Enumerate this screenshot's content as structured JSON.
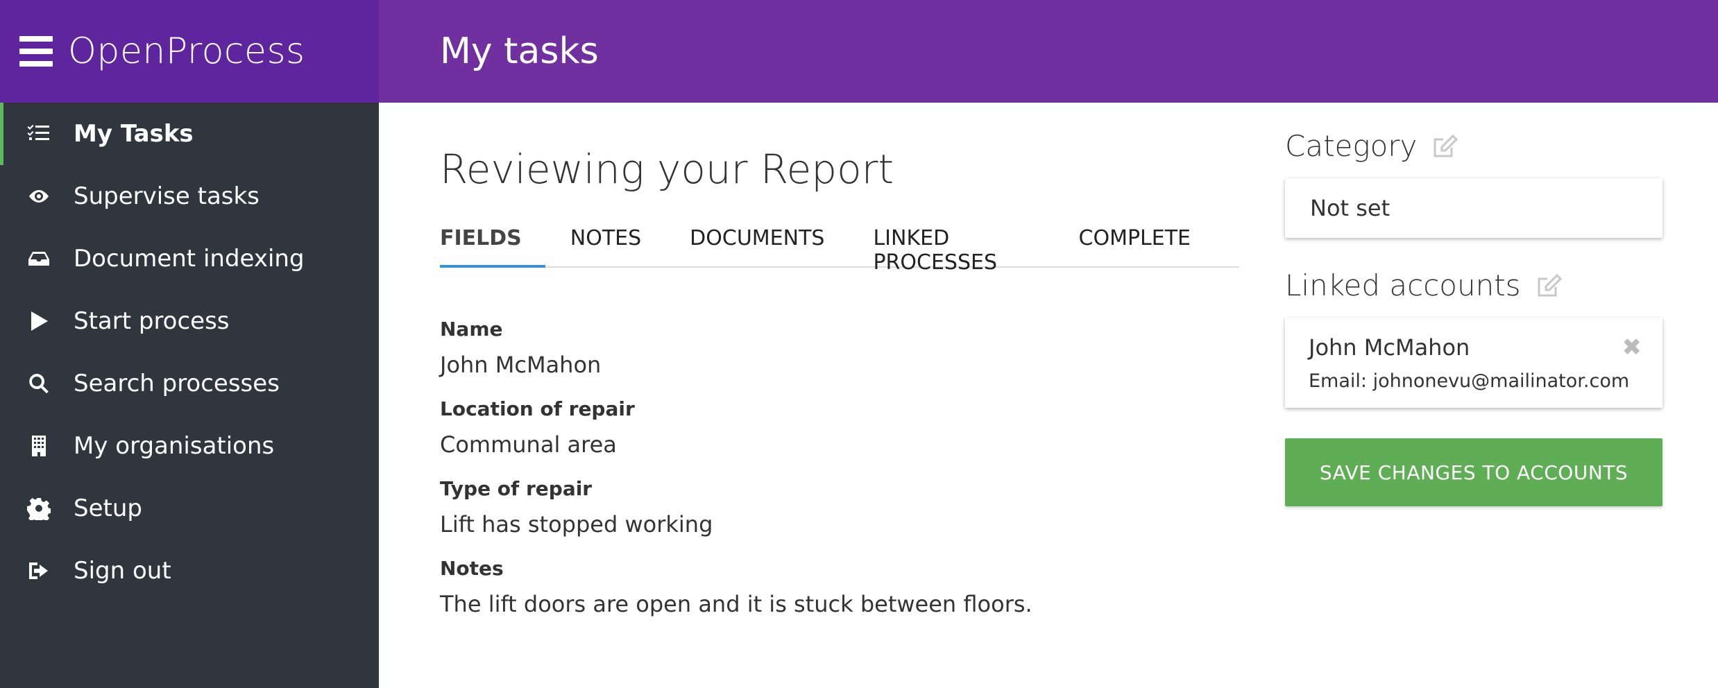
{
  "brand": {
    "name": "OpenProcess",
    "menu_icon": "hamburger-icon"
  },
  "header": {
    "title": "My tasks"
  },
  "sidebar": {
    "items": [
      {
        "label": "My Tasks",
        "icon": "tasks-list-icon",
        "active": true
      },
      {
        "label": "Supervise tasks",
        "icon": "eye-icon"
      },
      {
        "label": "Document indexing",
        "icon": "inbox-icon"
      },
      {
        "label": "Start process",
        "icon": "play-icon"
      },
      {
        "label": "Search processes",
        "icon": "search-icon"
      },
      {
        "label": "My organisations",
        "icon": "building-icon"
      },
      {
        "label": "Setup",
        "icon": "gear-icon"
      },
      {
        "label": "Sign out",
        "icon": "sign-out-icon"
      }
    ]
  },
  "main": {
    "title": "Reviewing your Report",
    "tabs": [
      {
        "label": "FIELDS",
        "active": true
      },
      {
        "label": "NOTES"
      },
      {
        "label": "DOCUMENTS"
      },
      {
        "label": "LINKED PROCESSES"
      },
      {
        "label": "COMPLETE"
      }
    ],
    "fields": [
      {
        "label": "Name",
        "value": "John McMahon"
      },
      {
        "label": "Location of repair",
        "value": "Communal area"
      },
      {
        "label": "Type of repair",
        "value": "Lift has stopped working"
      },
      {
        "label": "Notes",
        "value": "The lift doors are open and it is stuck between floors."
      }
    ]
  },
  "right_panel": {
    "category": {
      "heading": "Category",
      "value": "Not set",
      "edit_icon": "edit-icon"
    },
    "linked_accounts": {
      "heading": "Linked accounts",
      "edit_icon": "edit-icon",
      "accounts": [
        {
          "name": "John McMahon",
          "email": "Email: johnonevu@mailinator.com",
          "remove_icon": "close-icon"
        }
      ]
    },
    "save_button": {
      "label": "SAVE CHANGES TO ACCOUNTS"
    }
  },
  "colors": {
    "brand_bg": "#5f259f",
    "topbar_bg": "#7030a0",
    "sidebar_bg": "#2f363d",
    "active_indicator": "#5cb85c",
    "tab_underline": "#3b8fd9",
    "save_button_bg": "#5fae56"
  }
}
